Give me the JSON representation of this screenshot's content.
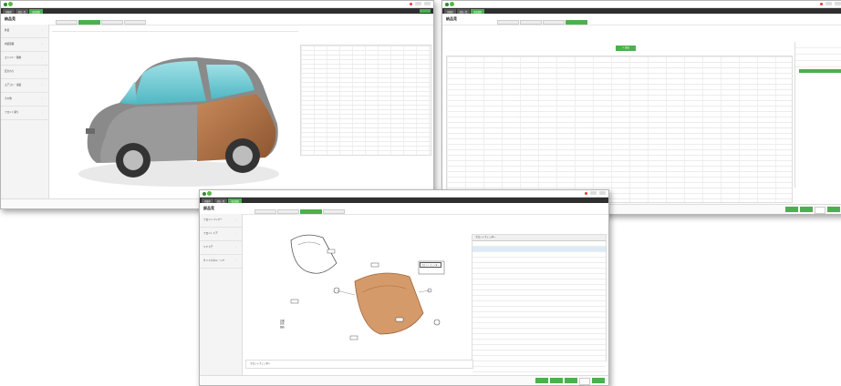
{
  "window1": {
    "page_title": "納品見",
    "tabs": [
      "見積書",
      "部品一覧",
      "部品選択"
    ],
    "sidebar_items": [
      "外装",
      "内装装備",
      "エンジン・駆動",
      "足まわり",
      "エアコン・電装",
      "その他",
      "フロント廻り"
    ],
    "accent_color": "#4caf50"
  },
  "window2": {
    "page_title": "納品見",
    "tabs": [
      "見積書",
      "部品一覧",
      "部品選択"
    ],
    "add_button": "+ 追加",
    "section_title": "部品見積明細"
  },
  "window3": {
    "page_title": "部品見",
    "tabs": [
      "見積書",
      "部品一覧",
      "部品選択"
    ],
    "sidebar_items": [
      "フロントバンパー",
      "フロントドア",
      "リヤドア",
      "サイドパネル・リヤ"
    ],
    "parts_header": "フロントフェンダー",
    "callout_text": [
      "フロントフェンダー",
      "エクステンション",
      "ガーニッシュ"
    ],
    "diagram_note": [
      "品番",
      "品名",
      "価格"
    ],
    "footer_row": "フロントフェンダー",
    "icons": [
      "logo",
      "green-leaf-icon",
      "notification-icon",
      "user-icon"
    ]
  }
}
